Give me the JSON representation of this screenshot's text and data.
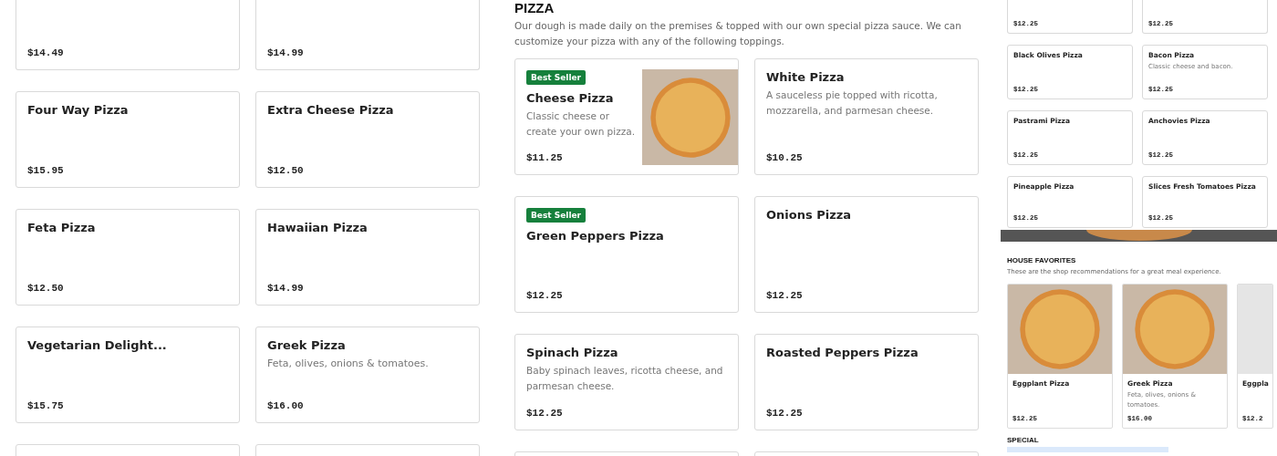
{
  "left_menu": {
    "items": [
      {
        "kind": "cut",
        "price": "$14.49"
      },
      {
        "kind": "cut",
        "price": "$14.99"
      },
      {
        "kind": "text",
        "name": "Four Way Pizza",
        "price": "$15.95"
      },
      {
        "kind": "text",
        "name": "Extra Cheese Pizza",
        "price": "$12.50"
      },
      {
        "kind": "text",
        "name": "Feta Pizza",
        "price": "$12.50"
      },
      {
        "kind": "text",
        "name": "Hawaiian Pizza",
        "price": "$14.99"
      },
      {
        "kind": "text",
        "name": "Vegetarian Delight...",
        "price": "$15.75"
      },
      {
        "kind": "text",
        "name": "Greek Pizza",
        "description": "Feta, olives, onions & tomatoes.",
        "price": "$16.00"
      },
      {
        "kind": "blank"
      },
      {
        "kind": "blank"
      }
    ]
  },
  "pizza_section": {
    "title": "PIZZA",
    "description": "Our dough is made daily on the premises & topped with our own special pizza sauce. We can customize your pizza with any of the following toppings.",
    "items": [
      {
        "kind": "photo",
        "badge": "Best Seller",
        "name": "Cheese Pizza",
        "description": "Classic cheese or create your own pizza.",
        "price": "$11.25"
      },
      {
        "kind": "text",
        "name": "White Pizza",
        "description": "A sauceless pie topped with ricotta, mozzarella, and parmesan cheese.",
        "price": "$10.25"
      },
      {
        "kind": "text",
        "badge": "Best Seller",
        "name": "Green Peppers Pizza",
        "price": "$12.25"
      },
      {
        "kind": "text",
        "name": "Onions Pizza",
        "price": "$12.25"
      },
      {
        "kind": "text",
        "name": "Spinach Pizza",
        "description": "Baby spinach leaves, ricotta cheese, and parmesan cheese.",
        "price": "$12.25"
      },
      {
        "kind": "text",
        "name": "Roasted Peppers Pizza",
        "price": "$12.25"
      },
      {
        "kind": "blank"
      },
      {
        "kind": "blank"
      }
    ]
  },
  "side_preview": {
    "items": [
      {
        "kind": "cut",
        "price": "$12.25"
      },
      {
        "kind": "cut",
        "price": "$12.25"
      },
      {
        "kind": "text",
        "name": "Black Olives Pizza",
        "price": "$12.25"
      },
      {
        "kind": "text",
        "name": "Bacon Pizza",
        "description": "Classic cheese and bacon.",
        "price": "$12.25"
      },
      {
        "kind": "text",
        "name": "Pastrami Pizza",
        "price": "$12.25"
      },
      {
        "kind": "text",
        "name": "Anchovies Pizza",
        "price": "$12.25"
      },
      {
        "kind": "text",
        "name": "Pineapple Pizza",
        "price": "$12.25"
      },
      {
        "kind": "text",
        "name": "Slices Fresh Tomatoes Pizza",
        "price": "$12.25"
      }
    ],
    "favorites": {
      "title": "HOUSE FAVORITES",
      "description": "These are the shop recommendations for a great meal experience.",
      "items": [
        {
          "kind": "photo",
          "name": "Eggplant Pizza",
          "price": "$12.25"
        },
        {
          "kind": "photo",
          "name": "Greek Pizza",
          "description": "Feta, olives, onions & tomatoes.",
          "price": "$16.00"
        },
        {
          "kind": "cut",
          "name": "Eggpla",
          "price": "$12.2"
        }
      ]
    },
    "special": {
      "title": "SPECIAL"
    }
  }
}
